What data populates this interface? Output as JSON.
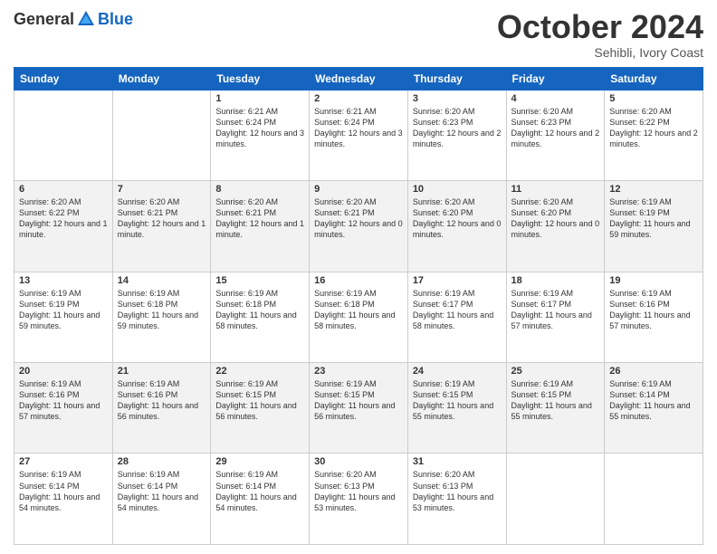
{
  "header": {
    "logo_general": "General",
    "logo_blue": "Blue",
    "month": "October 2024",
    "location": "Sehibli, Ivory Coast"
  },
  "weekdays": [
    "Sunday",
    "Monday",
    "Tuesday",
    "Wednesday",
    "Thursday",
    "Friday",
    "Saturday"
  ],
  "weeks": [
    [
      {
        "day": "",
        "content": ""
      },
      {
        "day": "",
        "content": ""
      },
      {
        "day": "1",
        "content": "Sunrise: 6:21 AM\nSunset: 6:24 PM\nDaylight: 12 hours and 3 minutes."
      },
      {
        "day": "2",
        "content": "Sunrise: 6:21 AM\nSunset: 6:24 PM\nDaylight: 12 hours and 3 minutes."
      },
      {
        "day": "3",
        "content": "Sunrise: 6:20 AM\nSunset: 6:23 PM\nDaylight: 12 hours and 2 minutes."
      },
      {
        "day": "4",
        "content": "Sunrise: 6:20 AM\nSunset: 6:23 PM\nDaylight: 12 hours and 2 minutes."
      },
      {
        "day": "5",
        "content": "Sunrise: 6:20 AM\nSunset: 6:22 PM\nDaylight: 12 hours and 2 minutes."
      }
    ],
    [
      {
        "day": "6",
        "content": "Sunrise: 6:20 AM\nSunset: 6:22 PM\nDaylight: 12 hours and 1 minute."
      },
      {
        "day": "7",
        "content": "Sunrise: 6:20 AM\nSunset: 6:21 PM\nDaylight: 12 hours and 1 minute."
      },
      {
        "day": "8",
        "content": "Sunrise: 6:20 AM\nSunset: 6:21 PM\nDaylight: 12 hours and 1 minute."
      },
      {
        "day": "9",
        "content": "Sunrise: 6:20 AM\nSunset: 6:21 PM\nDaylight: 12 hours and 0 minutes."
      },
      {
        "day": "10",
        "content": "Sunrise: 6:20 AM\nSunset: 6:20 PM\nDaylight: 12 hours and 0 minutes."
      },
      {
        "day": "11",
        "content": "Sunrise: 6:20 AM\nSunset: 6:20 PM\nDaylight: 12 hours and 0 minutes."
      },
      {
        "day": "12",
        "content": "Sunrise: 6:19 AM\nSunset: 6:19 PM\nDaylight: 11 hours and 59 minutes."
      }
    ],
    [
      {
        "day": "13",
        "content": "Sunrise: 6:19 AM\nSunset: 6:19 PM\nDaylight: 11 hours and 59 minutes."
      },
      {
        "day": "14",
        "content": "Sunrise: 6:19 AM\nSunset: 6:18 PM\nDaylight: 11 hours and 59 minutes."
      },
      {
        "day": "15",
        "content": "Sunrise: 6:19 AM\nSunset: 6:18 PM\nDaylight: 11 hours and 58 minutes."
      },
      {
        "day": "16",
        "content": "Sunrise: 6:19 AM\nSunset: 6:18 PM\nDaylight: 11 hours and 58 minutes."
      },
      {
        "day": "17",
        "content": "Sunrise: 6:19 AM\nSunset: 6:17 PM\nDaylight: 11 hours and 58 minutes."
      },
      {
        "day": "18",
        "content": "Sunrise: 6:19 AM\nSunset: 6:17 PM\nDaylight: 11 hours and 57 minutes."
      },
      {
        "day": "19",
        "content": "Sunrise: 6:19 AM\nSunset: 6:16 PM\nDaylight: 11 hours and 57 minutes."
      }
    ],
    [
      {
        "day": "20",
        "content": "Sunrise: 6:19 AM\nSunset: 6:16 PM\nDaylight: 11 hours and 57 minutes."
      },
      {
        "day": "21",
        "content": "Sunrise: 6:19 AM\nSunset: 6:16 PM\nDaylight: 11 hours and 56 minutes."
      },
      {
        "day": "22",
        "content": "Sunrise: 6:19 AM\nSunset: 6:15 PM\nDaylight: 11 hours and 56 minutes."
      },
      {
        "day": "23",
        "content": "Sunrise: 6:19 AM\nSunset: 6:15 PM\nDaylight: 11 hours and 56 minutes."
      },
      {
        "day": "24",
        "content": "Sunrise: 6:19 AM\nSunset: 6:15 PM\nDaylight: 11 hours and 55 minutes."
      },
      {
        "day": "25",
        "content": "Sunrise: 6:19 AM\nSunset: 6:15 PM\nDaylight: 11 hours and 55 minutes."
      },
      {
        "day": "26",
        "content": "Sunrise: 6:19 AM\nSunset: 6:14 PM\nDaylight: 11 hours and 55 minutes."
      }
    ],
    [
      {
        "day": "27",
        "content": "Sunrise: 6:19 AM\nSunset: 6:14 PM\nDaylight: 11 hours and 54 minutes."
      },
      {
        "day": "28",
        "content": "Sunrise: 6:19 AM\nSunset: 6:14 PM\nDaylight: 11 hours and 54 minutes."
      },
      {
        "day": "29",
        "content": "Sunrise: 6:19 AM\nSunset: 6:14 PM\nDaylight: 11 hours and 54 minutes."
      },
      {
        "day": "30",
        "content": "Sunrise: 6:20 AM\nSunset: 6:13 PM\nDaylight: 11 hours and 53 minutes."
      },
      {
        "day": "31",
        "content": "Sunrise: 6:20 AM\nSunset: 6:13 PM\nDaylight: 11 hours and 53 minutes."
      },
      {
        "day": "",
        "content": ""
      },
      {
        "day": "",
        "content": ""
      }
    ]
  ]
}
